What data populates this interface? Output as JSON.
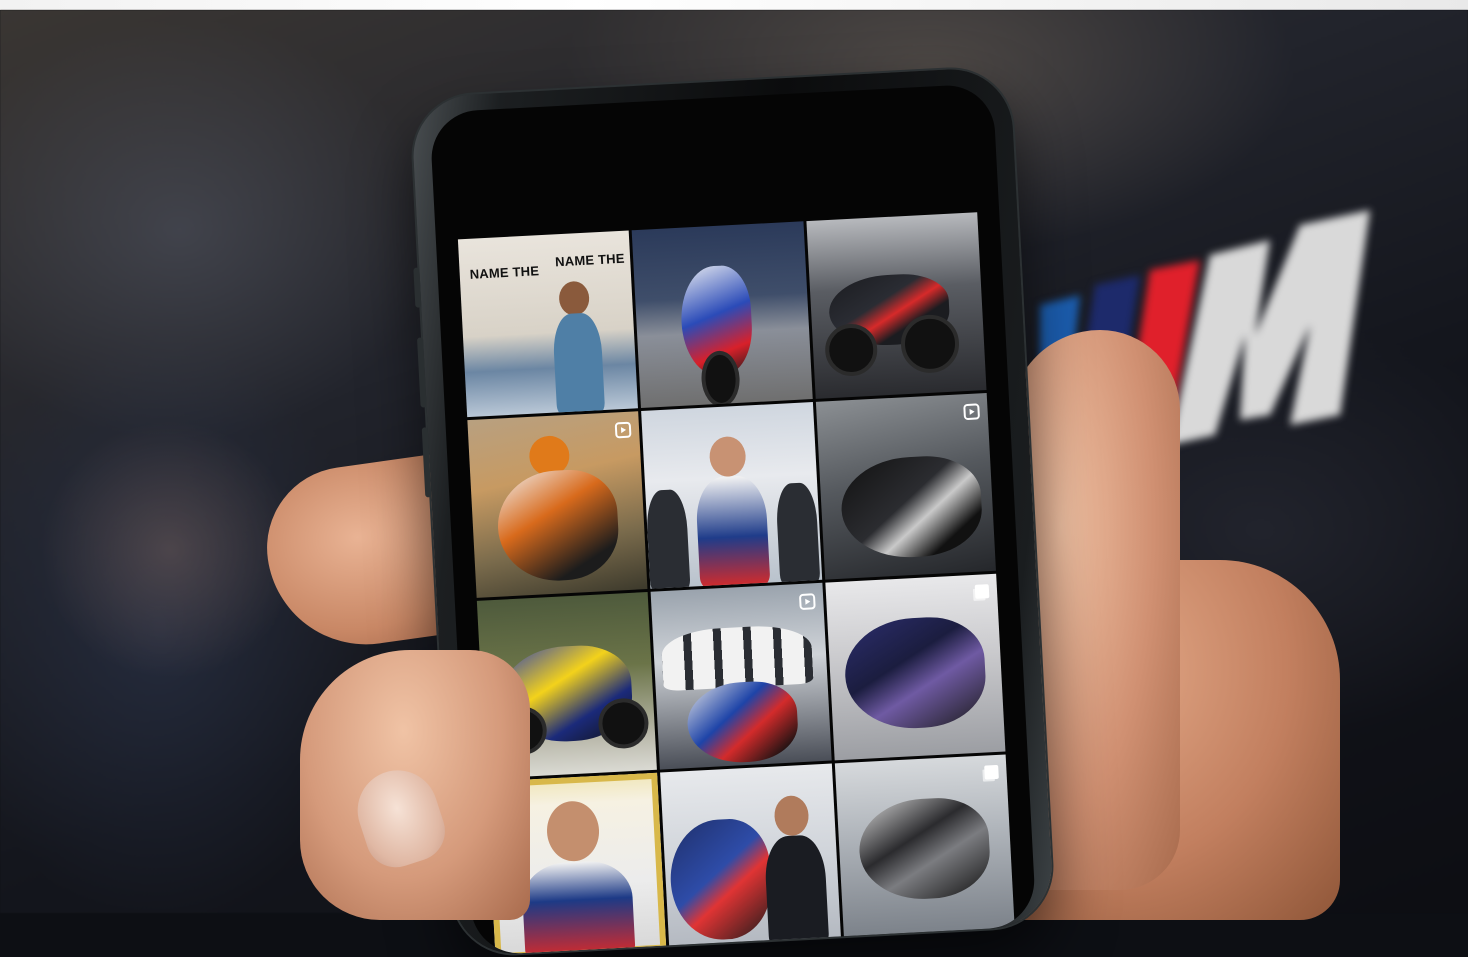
{
  "scene": {
    "description_colors": {
      "brand_blue": "#1c6dd0",
      "brand_dark_blue": "#1d2a6b",
      "brand_red": "#e0202b"
    }
  },
  "phone": {
    "feed_tiles": [
      {
        "caption_1": "NAME THE",
        "caption_2": "NAME THE",
        "icon": "none"
      },
      {
        "icon": "none"
      },
      {
        "icon": "none"
      },
      {
        "icon": "reel-icon"
      },
      {
        "icon": "none"
      },
      {
        "icon": "reel-icon"
      },
      {
        "icon": "none"
      },
      {
        "icon": "reel-icon"
      },
      {
        "icon": "multi-icon"
      },
      {
        "icon": "none"
      },
      {
        "icon": "none"
      },
      {
        "icon": "multi-icon"
      }
    ]
  }
}
